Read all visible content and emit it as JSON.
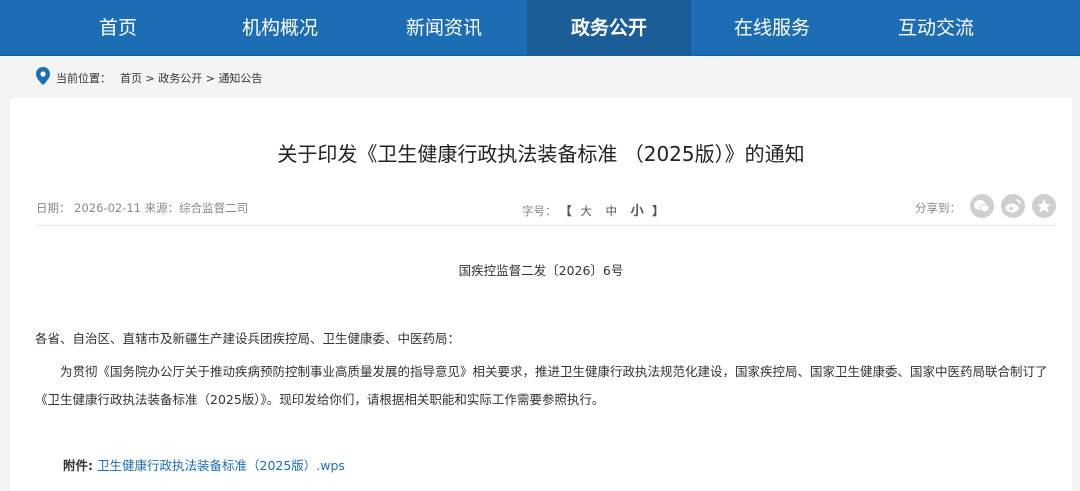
{
  "nav": {
    "items": [
      {
        "label": "首页"
      },
      {
        "label": "机构概况"
      },
      {
        "label": "新闻资讯"
      },
      {
        "label": "政务公开"
      },
      {
        "label": "在线服务"
      },
      {
        "label": "互动交流"
      }
    ],
    "active": "政务公开",
    "colors": {
      "bar": "#1d6db5",
      "active": "#1a5d97"
    }
  },
  "breadcrumb": {
    "label": "当前位置：",
    "home": "首页",
    "sep1": " > ",
    "section": "政务公开",
    "sep2": " > ",
    "current": "通知公告",
    "icon": "location-pin-icon"
  },
  "article": {
    "title": "关于印发《卫生健康行政执法装备标准 （2025版）》的通知",
    "meta": "日期：  2026-02-11 来源：综合监督二司",
    "fontsize": {
      "label": "字号：",
      "open": "【",
      "large": "大",
      "medium": "中",
      "small": "小",
      "close": "】"
    },
    "share": {
      "label": "分享到：",
      "icons": [
        "wechat-icon",
        "weibo-icon",
        "favorite-star-icon"
      ]
    },
    "doc_number": "国疾控监督二发〔2026〕6号",
    "addressee": "各省、自治区、直辖市及新疆生产建设兵团疾控局、卫生健康委、中医药局：",
    "body": "为贯彻《国务院办公厅关于推动疾病预防控制事业高质量发展的指导意见》相关要求，推进卫生健康行政执法规范化建设，国家疾控局、国家卫生健康委、国家中医药局联合制订了《卫生健康行政执法装备标准（2025版）》。现印发给你们，请根据相关职能和实际工作需要参照执行。",
    "attachment": {
      "label": "附件:",
      "link": "卫生健康行政执法装备标准（2025版）.wps"
    }
  }
}
